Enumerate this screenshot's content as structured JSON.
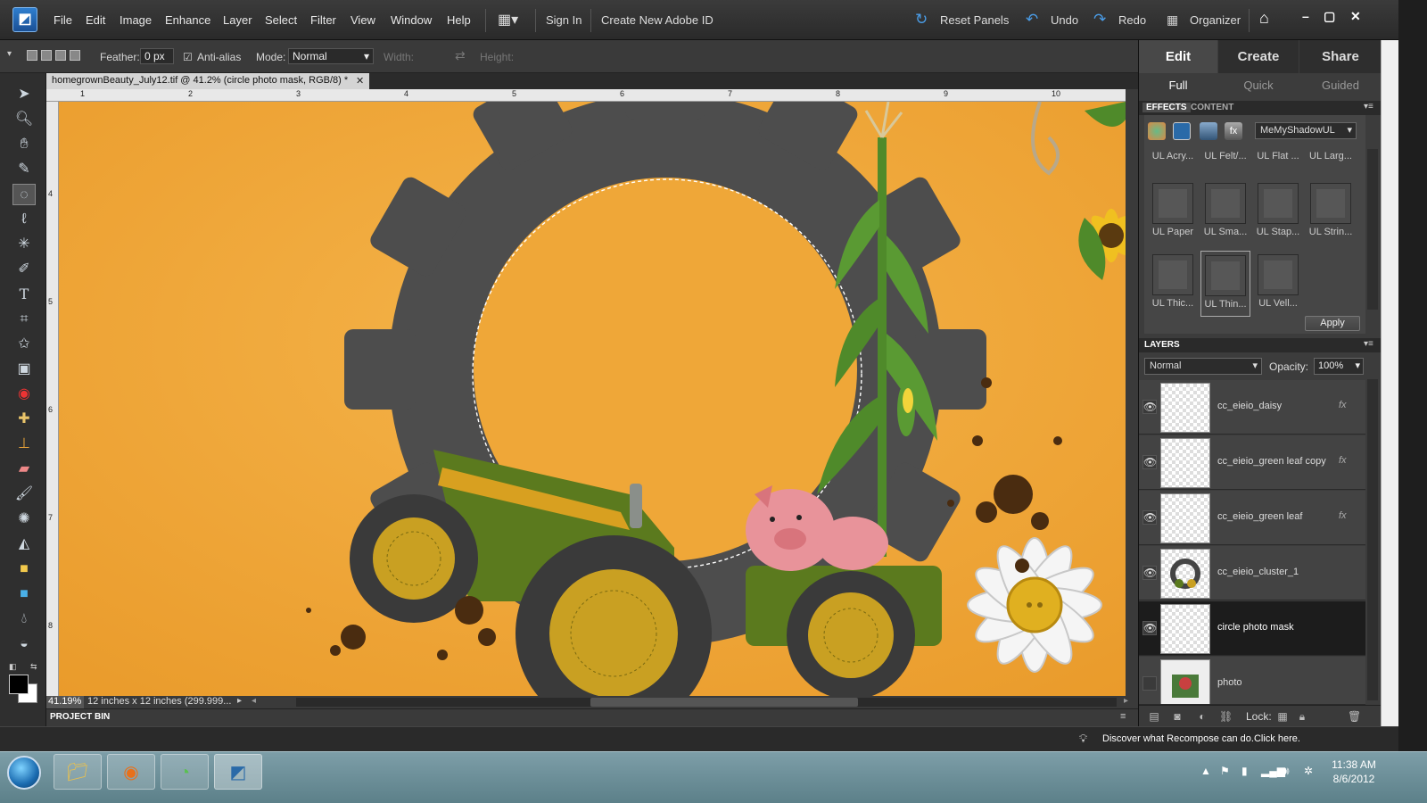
{
  "menubar": {
    "items": [
      "File",
      "Edit",
      "Image",
      "Enhance",
      "Layer",
      "Select",
      "Filter",
      "View",
      "Window",
      "Help"
    ],
    "sign_in": "Sign In",
    "create_id": "Create New Adobe ID",
    "reset_panels": "Reset Panels",
    "undo": "Undo",
    "redo": "Redo",
    "organizer": "Organizer"
  },
  "options": {
    "feather_label": "Feather:",
    "feather_value": "0 px",
    "antialias_label": "Anti-alias",
    "mode_label": "Mode:",
    "mode_value": "Normal",
    "width_label": "Width:",
    "height_label": "Height:"
  },
  "document": {
    "tab_title": "homegrownBeauty_July12.tif @ 41.2% (circle photo mask, RGB/8) *",
    "zoom": "41.19%",
    "info": "12 inches x 12 inches (299.999...",
    "ruler_h": [
      "1",
      "2",
      "3",
      "4",
      "5",
      "6",
      "7",
      "8",
      "9",
      "10"
    ],
    "ruler_v": [
      "4",
      "5",
      "6",
      "7",
      "8"
    ]
  },
  "project_bin": {
    "label": "PROJECT BIN"
  },
  "right_panel": {
    "tabs": [
      "Edit",
      "Create",
      "Share"
    ],
    "subtabs": [
      "Full",
      "Quick",
      "Guided"
    ],
    "effects_tab": "EFFECTS",
    "content_tab": "CONTENT",
    "style_dropdown": "MeMyShadowUL",
    "effects_row0": [
      "UL Acry...",
      "UL Felt/...",
      "UL Flat ...",
      "UL Larg..."
    ],
    "effects_row1": [
      "UL Paper",
      "UL Sma...",
      "UL Stap...",
      "UL Strin..."
    ],
    "effects_row2": [
      "UL Thic...",
      "UL Thin...",
      "UL Vell..."
    ],
    "apply": "Apply",
    "layers_label": "LAYERS",
    "blend_mode": "Normal",
    "opacity_label": "Opacity:",
    "opacity_value": "100%",
    "lock_label": "Lock:",
    "layers": [
      {
        "name": "cc_eieio_daisy"
      },
      {
        "name": "cc_eieio_green leaf copy"
      },
      {
        "name": "cc_eieio_green leaf"
      },
      {
        "name": "cc_eieio_cluster_1"
      },
      {
        "name": "circle photo mask"
      },
      {
        "name": "photo"
      }
    ]
  },
  "tip": {
    "text": "Discover what Recompose can do.Click here."
  },
  "taskbar": {
    "time": "11:38 AM",
    "date": "8/6/2012"
  }
}
